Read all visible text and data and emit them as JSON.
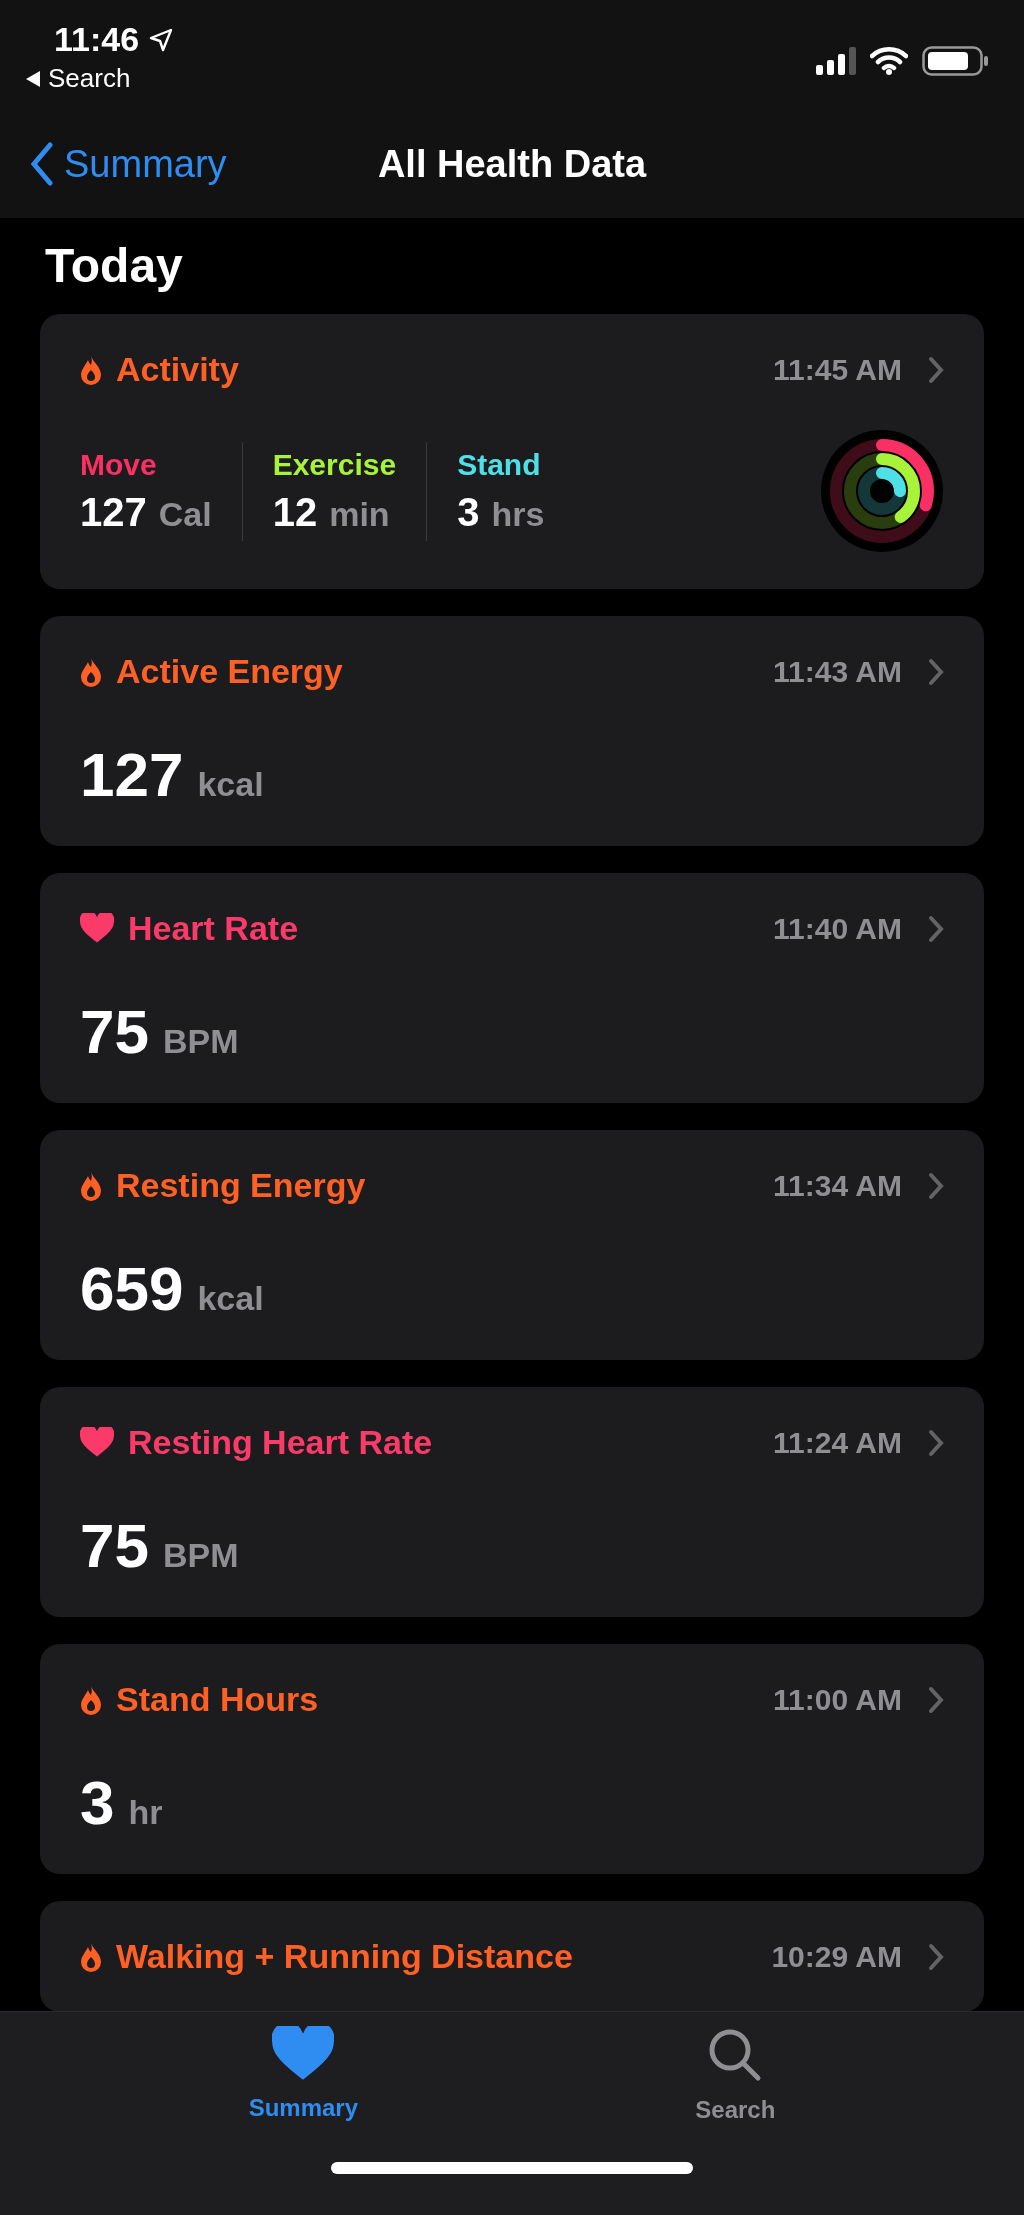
{
  "status_bar": {
    "time": "11:46",
    "back_label": "Search"
  },
  "nav": {
    "back": "Summary",
    "title": "All Health Data"
  },
  "section": "Today",
  "cards": [
    {
      "kind": "activity",
      "color": "#ff6025",
      "title": "Activity",
      "time": "11:45 AM",
      "stats": [
        {
          "label": "Move",
          "value": "127",
          "unit": "Cal",
          "color": "#fa2f63",
          "level": 0.3
        },
        {
          "label": "Exercise",
          "value": "12",
          "unit": "min",
          "color": "#a6f33a",
          "level": 0.4
        },
        {
          "label": "Stand",
          "value": "3",
          "unit": "hrs",
          "color": "#4ee0e6",
          "level": 0.25
        }
      ]
    },
    {
      "kind": "energy",
      "color": "#ff6025",
      "title": "Active Energy",
      "time": "11:43 AM",
      "value": "127",
      "unit": "kcal"
    },
    {
      "kind": "heart",
      "color": "#fa3b6a",
      "title": "Heart Rate",
      "time": "11:40 AM",
      "value": "75",
      "unit": "BPM"
    },
    {
      "kind": "energy",
      "color": "#ff6025",
      "title": "Resting Energy",
      "time": "11:34 AM",
      "value": "659",
      "unit": "kcal"
    },
    {
      "kind": "heart",
      "color": "#fa3b6a",
      "title": "Resting Heart Rate",
      "time": "11:24 AM",
      "value": "75",
      "unit": "BPM"
    },
    {
      "kind": "energy",
      "color": "#ff6025",
      "title": "Stand Hours",
      "time": "11:00 AM",
      "value": "3",
      "unit": "hr"
    },
    {
      "kind": "energy",
      "color": "#ff6025",
      "title": "Walking + Running Distance",
      "time": "10:29 AM"
    }
  ],
  "tabs": [
    {
      "label": "Summary",
      "selected": true
    },
    {
      "label": "Search",
      "selected": false
    }
  ]
}
